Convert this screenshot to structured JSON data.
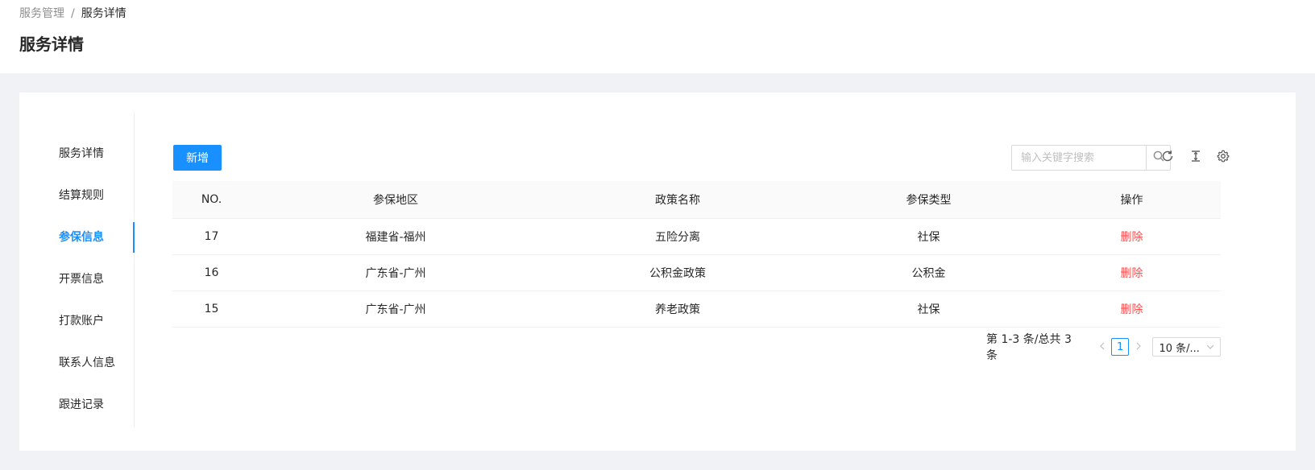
{
  "breadcrumb": {
    "parent": "服务管理",
    "separator": "/",
    "current": "服务详情"
  },
  "page_title": "服务详情",
  "side_menu": [
    {
      "label": "服务详情",
      "active": false
    },
    {
      "label": "结算规则",
      "active": false
    },
    {
      "label": "参保信息",
      "active": true
    },
    {
      "label": "开票信息",
      "active": false
    },
    {
      "label": "打款账户",
      "active": false
    },
    {
      "label": "联系人信息",
      "active": false
    },
    {
      "label": "跟进记录",
      "active": false
    }
  ],
  "toolbar": {
    "add_label": "新增",
    "search_placeholder": "输入关键字搜索",
    "icons": [
      "search-icon",
      "reload-icon",
      "column-height-icon",
      "setting-icon"
    ]
  },
  "table": {
    "headers": [
      "NO.",
      "参保地区",
      "政策名称",
      "参保类型",
      "操作"
    ],
    "rows": [
      {
        "no": "17",
        "region": "福建省-福州",
        "policy": "五险分离",
        "type": "社保",
        "action": "删除"
      },
      {
        "no": "16",
        "region": "广东省-广州",
        "policy": "公积金政策",
        "type": "公积金",
        "action": "删除"
      },
      {
        "no": "15",
        "region": "广东省-广州",
        "policy": "养老政策",
        "type": "社保",
        "action": "删除"
      }
    ]
  },
  "pagination": {
    "total_text": "第 1-3 条/总共 3 条",
    "current_page": "1",
    "page_size": "10 条/..."
  },
  "colors": {
    "primary": "#1890ff",
    "danger": "#ff4d4f",
    "background": "#f0f2f5"
  }
}
